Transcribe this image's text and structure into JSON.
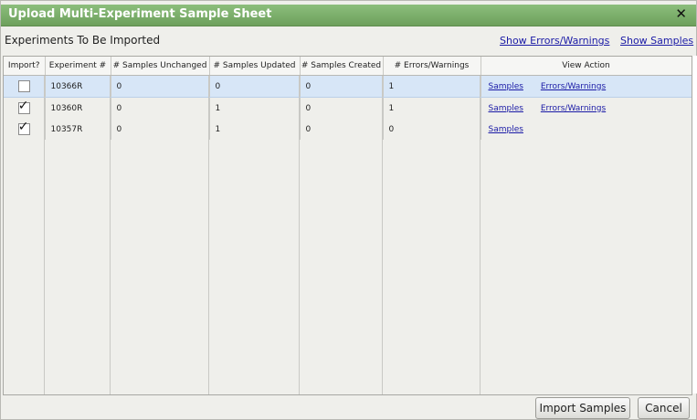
{
  "dialog": {
    "title": "Upload Multi-Experiment Sample Sheet",
    "close_icon": "close-icon"
  },
  "header": {
    "label": "Experiments To Be Imported",
    "show_errors_link": "Show Errors/Warnings",
    "show_samples_link": "Show Samples"
  },
  "table": {
    "columns": [
      "Import?",
      "Experiment #",
      "# Samples Unchanged",
      "# Samples Updated",
      "# Samples Created",
      "# Errors/Warnings",
      "View Action"
    ],
    "rows": [
      {
        "import": false,
        "experiment": "10366R",
        "unchanged": "0",
        "updated": "0",
        "created": "0",
        "errors": "1",
        "samples_link": "Samples",
        "errors_link": "Errors/Warnings",
        "selected": true
      },
      {
        "import": true,
        "experiment": "10360R",
        "unchanged": "0",
        "updated": "1",
        "created": "0",
        "errors": "1",
        "samples_link": "Samples",
        "errors_link": "Errors/Warnings",
        "selected": false
      },
      {
        "import": true,
        "experiment": "10357R",
        "unchanged": "0",
        "updated": "1",
        "created": "0",
        "errors": "0",
        "samples_link": "Samples",
        "errors_link": null,
        "selected": false
      }
    ]
  },
  "footer": {
    "import_button": "Import Samples",
    "cancel_button": "Cancel"
  },
  "colors": {
    "titlebar": "#7aae69",
    "selected_row": "#d7e6f7",
    "link": "#1a1aa6"
  }
}
